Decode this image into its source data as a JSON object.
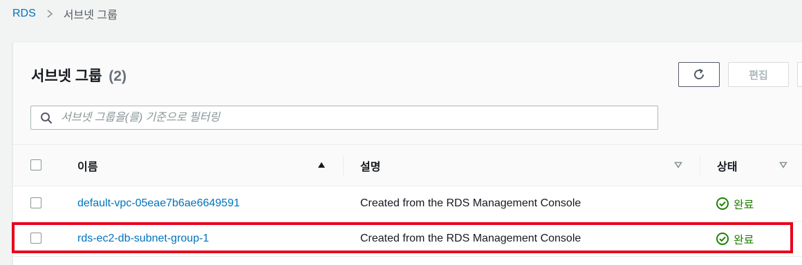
{
  "breadcrumb": {
    "root": "RDS",
    "current": "서브넷 그룹"
  },
  "panel": {
    "title": "서브넷 그룹",
    "count": "(2)",
    "edit_label": "편집"
  },
  "search": {
    "placeholder": "서브넷 그룹을(를) 기준으로 필터링",
    "value": ""
  },
  "table": {
    "columns": [
      {
        "label": "이름",
        "sort": "ascending"
      },
      {
        "label": "설명",
        "sort": "none"
      },
      {
        "label": "상태",
        "sort": "none"
      }
    ],
    "rows": [
      {
        "name": "default-vpc-05eae7b6ae6649591",
        "description": "Created from the RDS Management Console",
        "status": "완료"
      },
      {
        "name": "rds-ec2-db-subnet-group-1",
        "description": "Created from the RDS Management Console",
        "status": "완료"
      }
    ]
  },
  "icons": {
    "breadcrumb_separator": "chevron-right-icon",
    "refresh": "refresh-icon",
    "search": "search-icon",
    "sort_ascending": "caret-up-icon",
    "sort_none": "caret-down-outline-icon",
    "status_ok": "check-circle-icon"
  },
  "colors": {
    "link": "#0073bb",
    "success": "#1d8102",
    "highlight": "#e8001a"
  }
}
